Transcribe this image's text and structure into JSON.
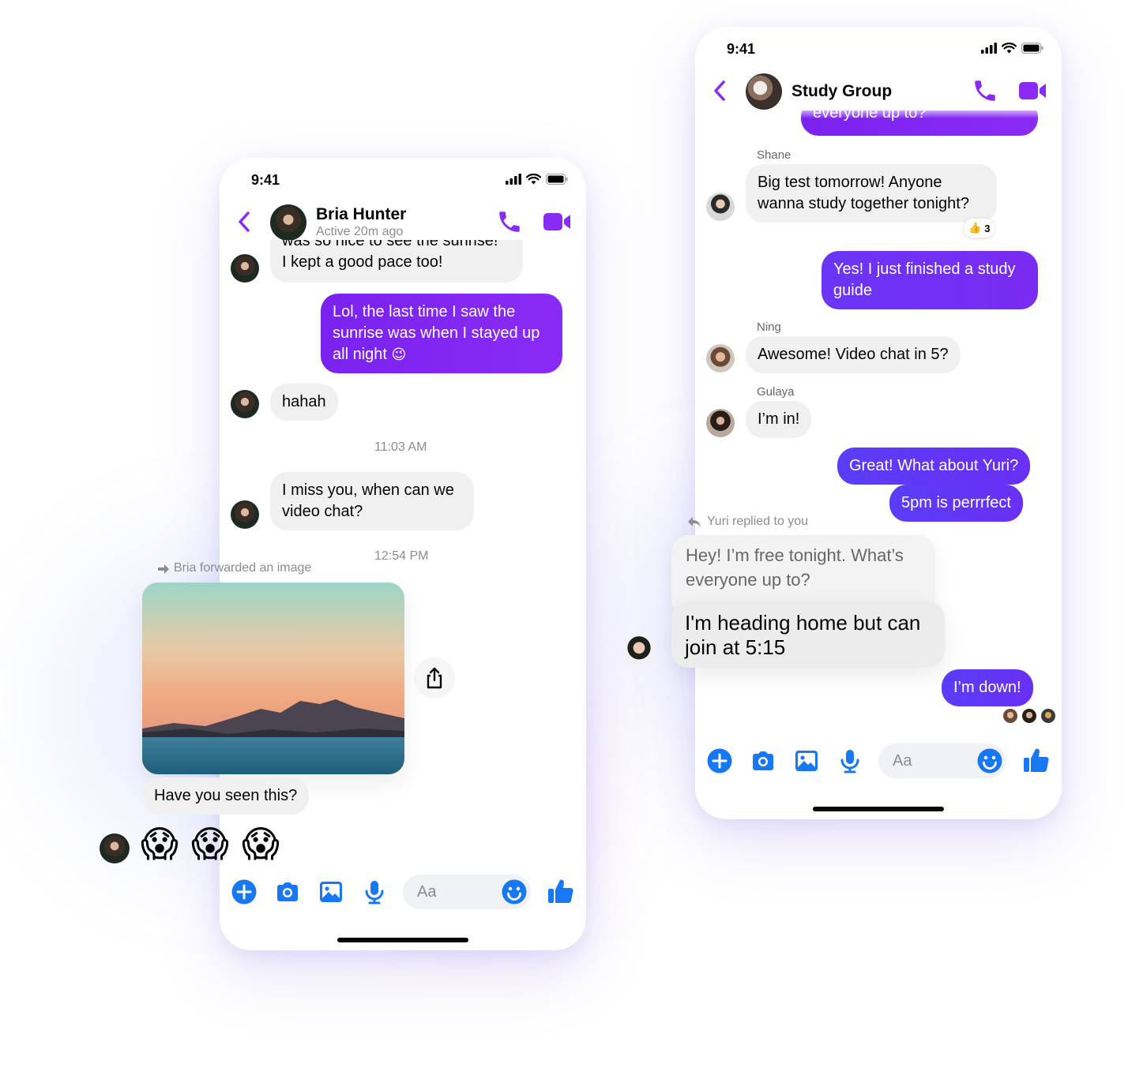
{
  "colors": {
    "messenger_purple": "#8a2bf5",
    "messenger_blue": "#1877f2",
    "incoming_bubble": "#f0f0f0",
    "secondary_text": "#8a8d91"
  },
  "left_phone": {
    "status_time": "9:41",
    "header": {
      "contact_name": "Bria Hunter",
      "active_status": "Active 20m ago",
      "icons": [
        "back-chevron-icon",
        "phone-icon",
        "video-camera-icon"
      ]
    },
    "messages": {
      "partial_top": "was so nice to see the sunrise!",
      "m1": "I kept a good pace too!",
      "m2": "Lol, the last time I saw the sunrise was when I stayed up all night",
      "m2_emoji": "😉",
      "m3": "hahah",
      "timestamp1": "11:03 AM",
      "m4": "I miss you, when can we video chat?",
      "timestamp2": "12:54 PM",
      "forward_note": "Bria forwarded an image",
      "m5": "Have you seen this?",
      "reaction_emoji": "😱"
    },
    "composer": {
      "placeholder": "Aa",
      "icons": [
        "plus-icon",
        "camera-icon",
        "gallery-icon",
        "microphone-icon",
        "smiley-icon",
        "thumbs-up-icon"
      ]
    }
  },
  "right_phone": {
    "status_time": "9:41",
    "header": {
      "group_name": "Study Group",
      "icons": [
        "back-chevron-icon",
        "phone-icon",
        "video-camera-icon"
      ]
    },
    "messages": {
      "partial_top": "everyone up to?",
      "sender_shane": "Shane",
      "m1": "Big test tomorrow! Anyone wanna study together tonight?",
      "m1_reaction_count": "3",
      "m1_reaction": "👍",
      "m2": "Yes! I just finished a study guide",
      "sender_ning": "Ning",
      "m3": "Awesome! Video chat in 5?",
      "sender_gulaya": "Gulaya",
      "m4": "I’m in!",
      "m5": "Great! What about Yuri?",
      "m6": "5pm is perrrfect",
      "reply_note": "Yuri replied to you",
      "quoted": "Hey! I’m free tonight. What’s everyone up to?",
      "m7": "I'm heading home but can join at 5:15",
      "m8": "I’m down!"
    },
    "composer": {
      "placeholder": "Aa",
      "icons": [
        "plus-icon",
        "camera-icon",
        "gallery-icon",
        "microphone-icon",
        "smiley-icon",
        "thumbs-up-icon"
      ]
    }
  }
}
